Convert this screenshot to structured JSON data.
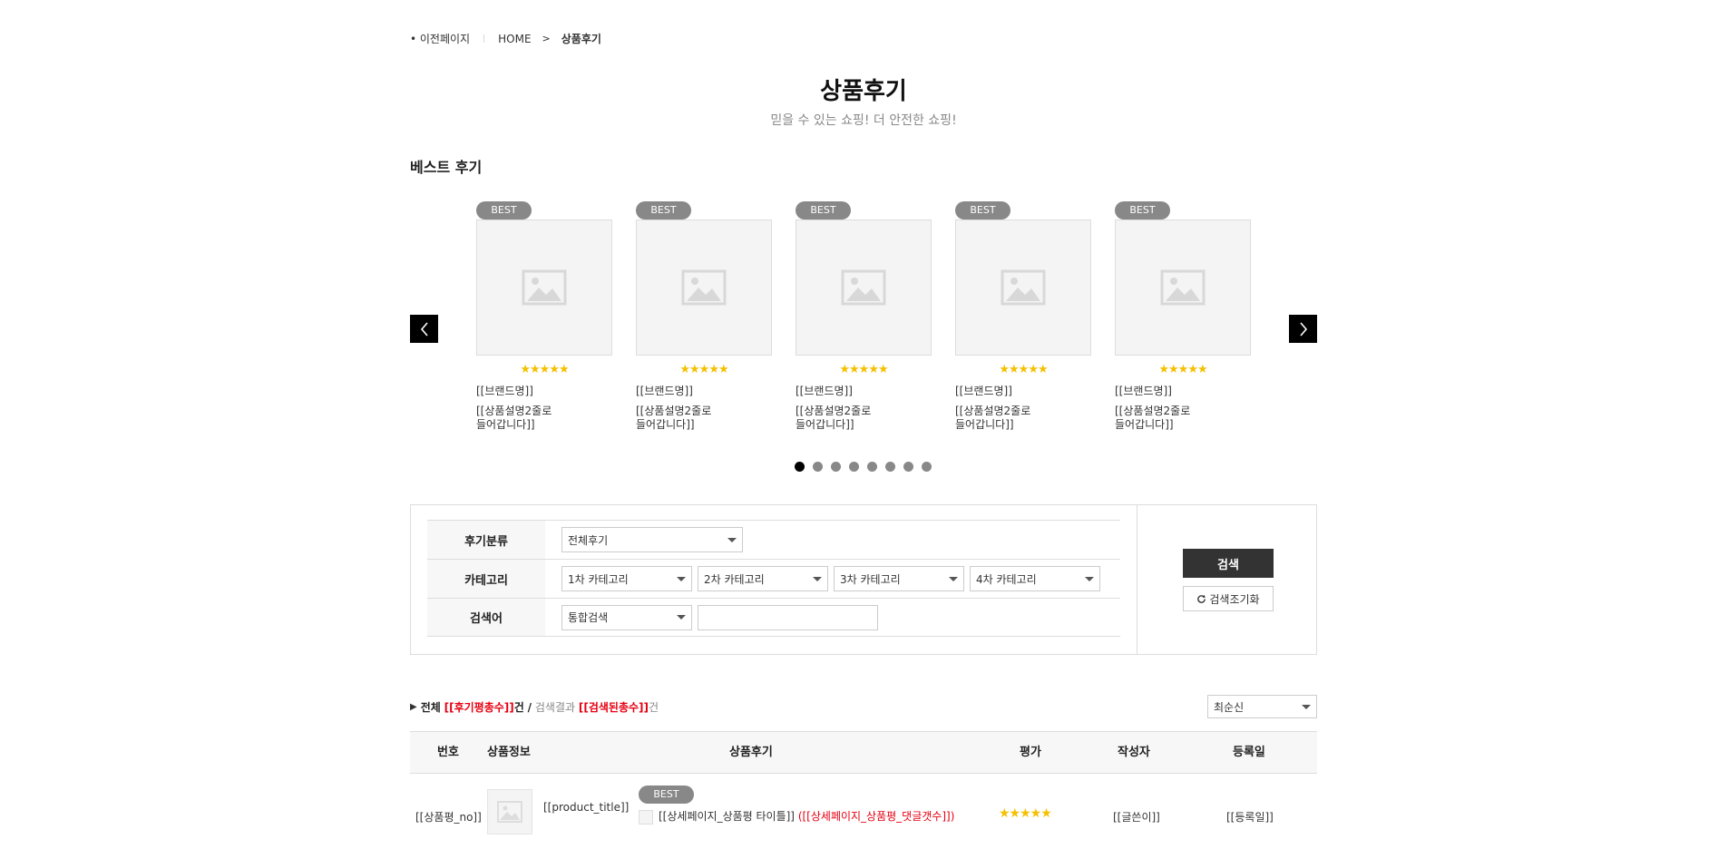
{
  "breadcrumb": {
    "prev": "• 이전페이지",
    "sep": "|",
    "home": "HOME",
    "arrow": ">",
    "current": "상품후기"
  },
  "page": {
    "title": "상품후기",
    "subtitle": "믿을 수 있는 쇼핑! 더 안전한 쇼핑!"
  },
  "best_section": {
    "title": "베스트 후기"
  },
  "carousel": {
    "cards": [
      {
        "badge": "BEST",
        "stars": "★★★★★",
        "rating": 5,
        "brand": "[[브랜드명]]",
        "desc_line1": "[[상품설명2줄로",
        "desc_line2": "들어갑니다]]"
      },
      {
        "badge": "BEST",
        "stars": "★★★★★",
        "rating": 5,
        "brand": "[[브랜드명]]",
        "desc_line1": "[[상품설명2줄로",
        "desc_line2": "들어갑니다]]"
      },
      {
        "badge": "BEST",
        "stars": "★★★★★",
        "rating": 5,
        "brand": "[[브랜드명]]",
        "desc_line1": "[[상품설명2줄로",
        "desc_line2": "들어갑니다]]"
      },
      {
        "badge": "BEST",
        "stars": "★★★★★",
        "rating": 5,
        "brand": "[[브랜드명]]",
        "desc_line1": "[[상품설명2줄로",
        "desc_line2": "들어갑니다]]"
      },
      {
        "badge": "BEST",
        "stars": "★★★★★",
        "rating": 5,
        "brand": "[[브랜드명]]",
        "desc_line1": "[[상품설명2줄로",
        "desc_line2": "들어갑니다]]"
      }
    ],
    "page_count": 8,
    "active_page": 1
  },
  "search": {
    "review_type_label": "후기분류",
    "review_type_value": "전체후기",
    "category_label": "카테고리",
    "categories": [
      "1차 카테고리",
      "2차 카테고리",
      "3차 카테고리",
      "4차 카테고리"
    ],
    "keyword_label": "검색어",
    "keyword_type": "통합검색",
    "keyword_value": "",
    "search_button": "검색",
    "reset_button": "검색조기화"
  },
  "summary": {
    "total_label": "전체",
    "total_value": "[[후기평총수]]",
    "unit": "건",
    "slash": "/",
    "result_label": "검색결과",
    "result_value": "[[검색된총수]]",
    "sort_value": "최순신"
  },
  "table": {
    "headers": {
      "no": "번호",
      "product": "상품정보",
      "review": "상품후기",
      "rating": "평가",
      "author": "작성자",
      "date": "등록일"
    },
    "rows": [
      {
        "no": "[[상품평_no]]",
        "product_title": "[[product_title]]",
        "badge": "BEST",
        "review_title": "[[상세페이지_상품평 타이틀]]",
        "comment_count": "([[상세페이지_상품평_댓글갯수]])",
        "stars": "★★★★★",
        "rating": 5,
        "author": "[[글쓴이]]",
        "date": "[[등록일]]"
      }
    ]
  },
  "colors": {
    "accent_red": "#e60012",
    "star": "#f5c000",
    "badge": "#888888",
    "button_dark": "#333333"
  }
}
